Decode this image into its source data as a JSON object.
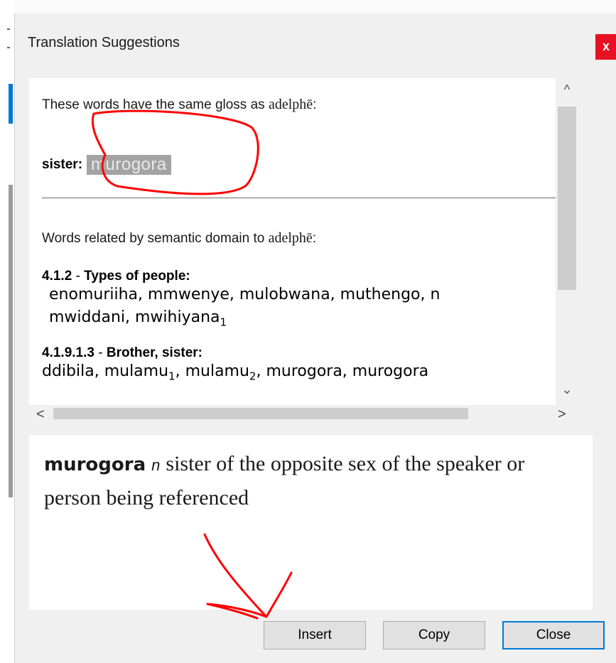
{
  "window": {
    "title": "Translation Suggestions",
    "close_glyph": "x"
  },
  "same_gloss": {
    "intro_prefix": "These words have the same gloss as ",
    "source_word": "adelphē",
    "intro_suffix": ":",
    "entries": [
      {
        "gloss": "sister:",
        "word": "murogora"
      }
    ]
  },
  "semantic": {
    "intro_prefix": "Words related by semantic domain to ",
    "source_word": "adelphē",
    "intro_suffix": ":",
    "domains": [
      {
        "number": "4.1.2",
        "sep": " - ",
        "title": "Types of people:",
        "line1": "enomuriiha, mmwenye, mulobwana, muthengo, n",
        "line2_prefix": "mwiddani, mwihiyana",
        "line2_sub": "1"
      },
      {
        "number": "4.1.9.1.3",
        "sep": " - ",
        "title": "Brother, sister:",
        "w1": "ddibila, mulamu",
        "s1": "1",
        "w2": ", mulamu",
        "s2": "2",
        "w3": ", murogora, murogora",
        "trail": "("
      }
    ]
  },
  "definition": {
    "headword": "murogora",
    "pos": "n",
    "text": "sister of the opposite sex of the speaker or person being referenced"
  },
  "buttons": {
    "insert": "Insert",
    "copy": "Copy",
    "close": "Close"
  },
  "scroll": {
    "up": "^",
    "down": "⌄",
    "left": "<",
    "right": ">"
  },
  "colors": {
    "close_bg": "#e81123",
    "highlight_bg": "#a3a3a3",
    "annotation": "#ff0000",
    "default_button_border": "#0078d7"
  }
}
